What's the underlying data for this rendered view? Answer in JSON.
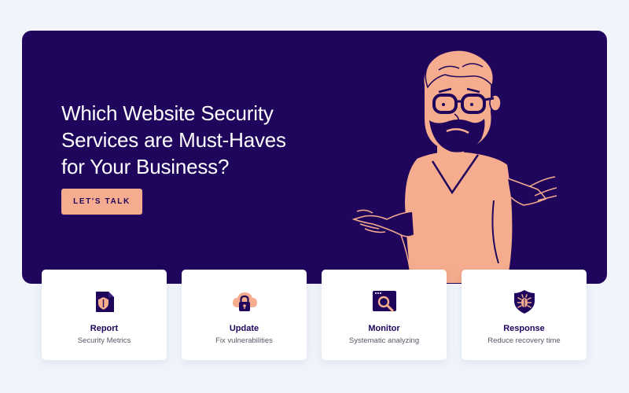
{
  "hero": {
    "title": "Which Website Security\nServices are Must-Haves\nfor Your Business?",
    "cta_label": "LET'S TALK",
    "illustration": "confused-man-shrugging"
  },
  "features": [
    {
      "title": "Report",
      "subtitle": "Security Metrics",
      "icon": "shield-report-icon"
    },
    {
      "title": "Update",
      "subtitle": "Fix vulnerabilities",
      "icon": "cloud-lock-icon"
    },
    {
      "title": "Monitor",
      "subtitle": "Systematic analyzing",
      "icon": "window-magnifier-icon"
    },
    {
      "title": "Response",
      "subtitle": "Reduce recovery time",
      "icon": "shield-bug-icon"
    }
  ],
  "colors": {
    "background": "#f1f5fb",
    "hero_bg": "#1f065c",
    "accent": "#f6ac8e",
    "card_bg": "#ffffff",
    "text_dark": "#1f065c"
  }
}
